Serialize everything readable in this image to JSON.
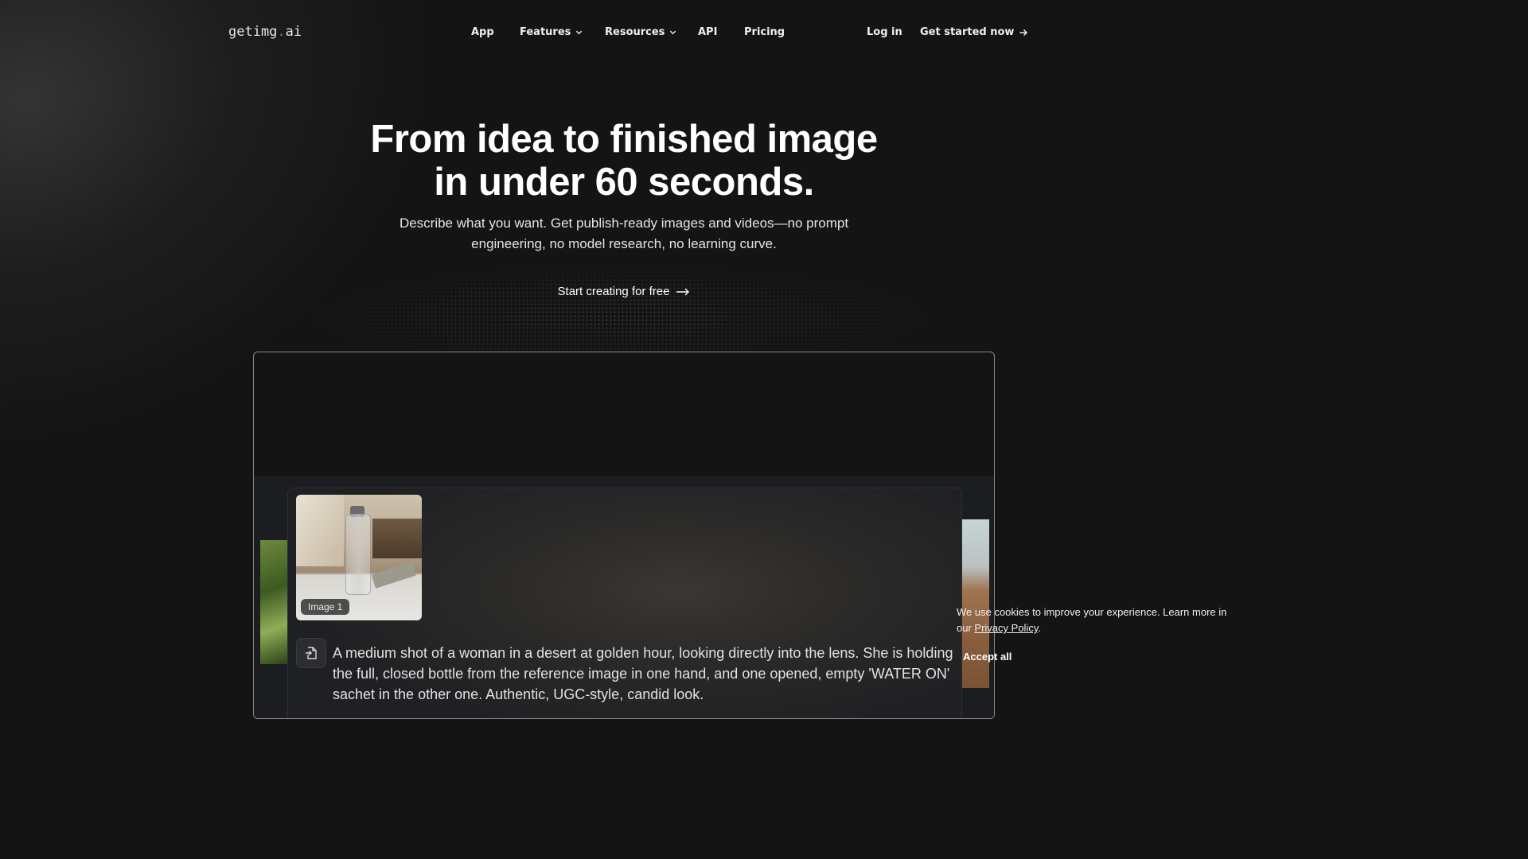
{
  "header": {
    "logo": {
      "part1": "getimg",
      "dot": ".",
      "part2": "ai"
    },
    "nav": [
      {
        "label": "App"
      },
      {
        "label": "Features"
      },
      {
        "label": "Resources"
      },
      {
        "label": "API"
      },
      {
        "label": "Pricing"
      }
    ],
    "login": "Log in",
    "get_started": "Get started now"
  },
  "hero": {
    "title_line1": "From idea to finished image",
    "title_line2": "in under 60 seconds.",
    "subtitle_line1": "Describe what you want. Get publish-ready images and videos—no prompt",
    "subtitle_line2": "engineering, no model research, no learning curve.",
    "cta": "Start creating for free"
  },
  "showcase": {
    "image_label": "Image 1",
    "prompt": "A medium shot of a woman in a desert at golden hour, looking directly into the lens. She is holding the full, closed bottle from the reference image in one hand, and one opened, empty 'WATER ON' sachet in the other one. Authentic, UGC-style, candid look."
  },
  "cookie": {
    "text": "We use cookies to improve your experience. Learn more in our",
    "link": "Privacy Policy",
    "period": ".",
    "accept": "Accept all"
  },
  "icons": {
    "features_chevron": "chevron-down-icon",
    "resources_chevron": "chevron-down-icon",
    "get_started_arrow": "arrow-right-icon",
    "cta_arrow": "long-arrow-right-icon",
    "attach": "file-import-icon"
  }
}
